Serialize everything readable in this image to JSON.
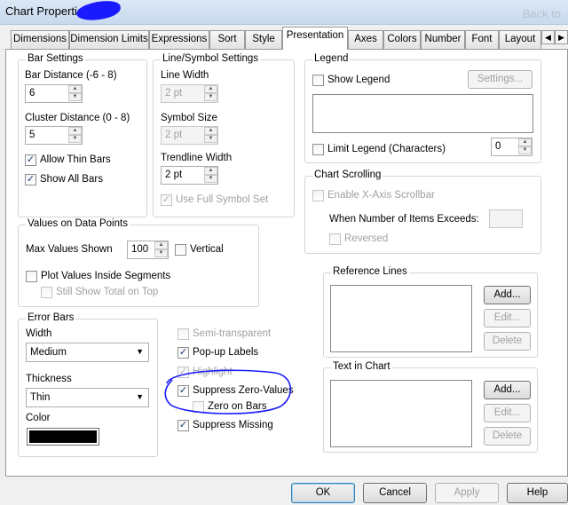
{
  "window": {
    "title": "Chart Properties",
    "ghost_text": "Back to"
  },
  "tabs": [
    {
      "label": "Dimensions"
    },
    {
      "label": "Dimension Limits"
    },
    {
      "label": "Expressions"
    },
    {
      "label": "Sort"
    },
    {
      "label": "Style"
    },
    {
      "label": "Presentation"
    },
    {
      "label": "Axes"
    },
    {
      "label": "Colors"
    },
    {
      "label": "Number"
    },
    {
      "label": "Font"
    },
    {
      "label": "Layout"
    }
  ],
  "active_tab": "Presentation",
  "bar_settings": {
    "title": "Bar Settings",
    "bar_distance_label": "Bar Distance (-6 - 8)",
    "bar_distance": "6",
    "cluster_distance_label": "Cluster Distance (0 - 8)",
    "cluster_distance": "5",
    "allow_thin_bars_label": "Allow Thin Bars",
    "allow_thin_bars": true,
    "show_all_bars_label": "Show All Bars",
    "show_all_bars": true
  },
  "line_symbol": {
    "title": "Line/Symbol Settings",
    "line_width_label": "Line Width",
    "line_width": "2 pt",
    "symbol_size_label": "Symbol Size",
    "symbol_size": "2 pt",
    "trendline_width_label": "Trendline Width",
    "trendline_width": "2 pt",
    "use_full_symbol_set_label": "Use Full Symbol Set",
    "use_full_symbol_set": true
  },
  "legend": {
    "title": "Legend",
    "show_legend_label": "Show Legend",
    "show_legend": false,
    "settings_label": "Settings...",
    "limit_legend_label": "Limit Legend (Characters)",
    "limit_legend": false,
    "limit_value": "0"
  },
  "chart_scrolling": {
    "title": "Chart Scrolling",
    "enable_label": "Enable X-Axis Scrollbar",
    "when_label": "When Number of Items Exceeds:",
    "reversed_label": "Reversed"
  },
  "values_on_data_points": {
    "title": "Values on Data Points",
    "max_values_label": "Max Values Shown",
    "max_values": "100",
    "vertical_label": "Vertical",
    "plot_inside_label": "Plot Values Inside Segments",
    "still_show_total_label": "Still Show Total on Top"
  },
  "reference_lines": {
    "title": "Reference Lines",
    "add": "Add...",
    "edit": "Edit...",
    "delete": "Delete"
  },
  "text_in_chart": {
    "title": "Text in Chart",
    "add": "Add...",
    "edit": "Edit...",
    "delete": "Delete"
  },
  "error_bars": {
    "title": "Error Bars",
    "width_label": "Width",
    "width_value": "Medium",
    "thickness_label": "Thickness",
    "thickness_value": "Thin",
    "color_label": "Color",
    "color_hex": "#000000"
  },
  "misc": {
    "semi_transparent_label": "Semi-transparent",
    "popup_labels_label": "Pop-up Labels",
    "highlight_label": "Highlight",
    "suppress_zero_label": "Suppress Zero-Values",
    "zero_on_bars_label": "Zero on Bars",
    "suppress_missing_label": "Suppress Missing"
  },
  "footer": {
    "ok": "OK",
    "cancel": "Cancel",
    "apply": "Apply",
    "help": "Help"
  },
  "annotation_color": "#1a1aff",
  "icons": {
    "check": "✓",
    "spin_up": "▲",
    "spin_down": "▼",
    "dropdown": "▼",
    "scroll_left": "◀",
    "scroll_right": "▶"
  }
}
